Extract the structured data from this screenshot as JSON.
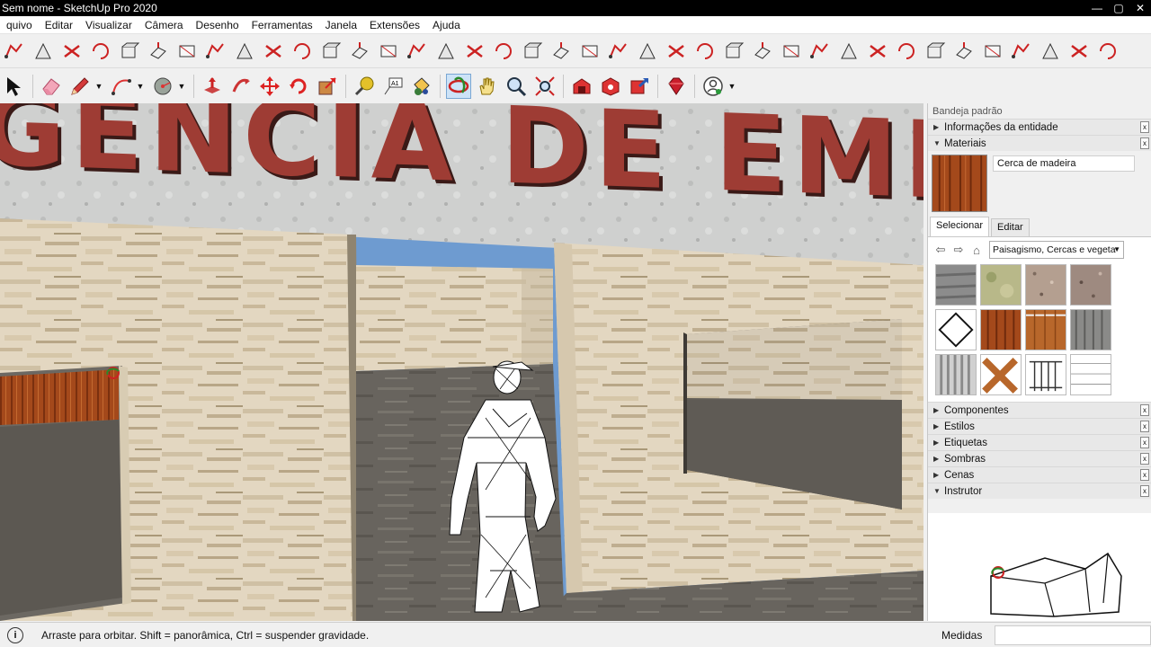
{
  "window": {
    "title": "Sem nome - SketchUp Pro 2020",
    "controls": [
      "—",
      "▢",
      "✕"
    ]
  },
  "menu": [
    "quivo",
    "Editar",
    "Visualizar",
    "Câmera",
    "Desenho",
    "Ferramentas",
    "Janela",
    "Extensões",
    "Ajuda"
  ],
  "toolbar_top_icons": [
    "follow-me-icon",
    "move-icon",
    "cut-icon",
    "rotate-icon",
    "orbit-ext-icon",
    "box-icon",
    "push-icon",
    "intersect-icon",
    "trim-icon",
    "line-tool-icon",
    "pen-icon",
    "curve-icon",
    "profile-icon",
    "edge-icon",
    "stair-icon",
    "fence-icon",
    "roof-icon",
    "gear-icon",
    "glove-icon",
    "wall-icon",
    "chamfer-icon",
    "door-icon",
    "railing-icon",
    "beam-icon",
    "truss-icon",
    "column-icon",
    "slab-icon",
    "floor-icon",
    "shape-icon",
    "facade-icon",
    "grid-icon",
    "grid2-icon",
    "frame-icon",
    "panel-icon",
    "hex-icon",
    "hex2-icon",
    "louver-icon",
    "bridge-icon",
    "house-icon"
  ],
  "toolbar_main": {
    "groups": [
      [
        "select-icon"
      ],
      [
        "eraser-icon"
      ],
      [
        "pencil-icon",
        "arc-icon",
        "circle-icon"
      ],
      [
        "push-pull-icon",
        "follow-icon",
        "move-icon",
        "rotate-icon",
        "scale-icon"
      ],
      [
        "tape-icon",
        "text-label-icon",
        "paint-bucket-icon"
      ],
      [
        "orbit-icon",
        "pan-icon",
        "zoom-icon",
        "zoom-extents-icon"
      ],
      [
        "warehouse-icon",
        "extension-icon",
        "share-icon"
      ],
      [
        "ruby-icon"
      ],
      [
        "profile-icon"
      ]
    ]
  },
  "viewport": {
    "sign_text": "GENCIA DE EMPREGO"
  },
  "tray": {
    "title": "Bandeja padrão",
    "entity_info": "Informações da entidade",
    "materials": {
      "header": "Materiais",
      "name": "Cerca de madeira",
      "tabs": [
        "Selecionar",
        "Editar"
      ],
      "library": "Paisagismo, Cercas e vegeta",
      "nav_back": "⇦",
      "nav_fwd": "⇨",
      "nav_home": "⌂"
    },
    "panels": [
      "Componentes",
      "Estilos",
      "Etiquetas",
      "Sombras",
      "Cenas"
    ],
    "instructor": "Instrutor",
    "collapsed_arrow": "▶",
    "expanded_arrow": "▼",
    "close_glyph": "x"
  },
  "status": {
    "info_glyph": "i",
    "message": "Arraste para orbitar. Shift = panorâmica, Ctrl = suspender gravidade.",
    "measurements_label": "Medidas"
  },
  "colors": {
    "letters": "#9e3c34",
    "wood": "#a0481c",
    "sky": "#5f8fc4",
    "active_tool": "#cde3f7"
  }
}
